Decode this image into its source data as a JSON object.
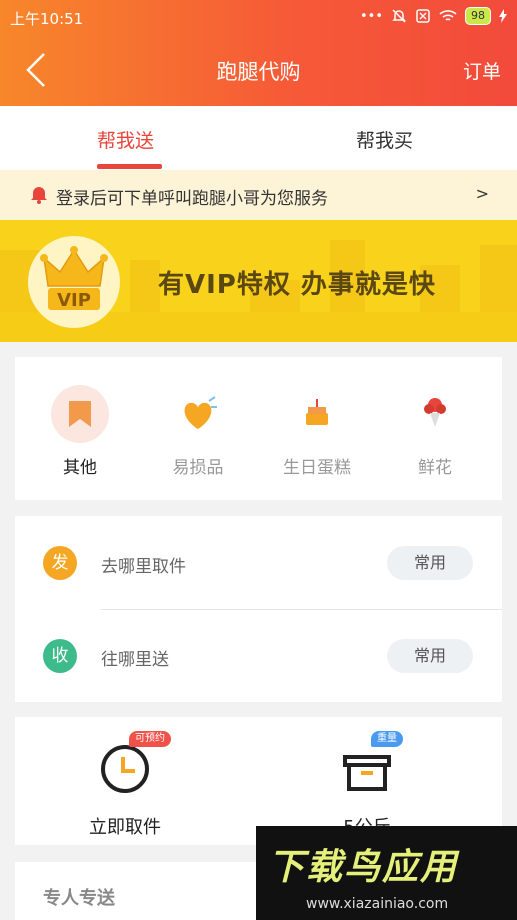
{
  "status_bar": {
    "time": "上午10:51",
    "battery": "98"
  },
  "nav": {
    "title": "跑腿代购",
    "right_action": "订单"
  },
  "tabs": [
    {
      "label": "帮我送",
      "active": true
    },
    {
      "label": "帮我买",
      "active": false
    }
  ],
  "notice": {
    "text": "登录后可下单呼叫跑腿小哥为您服务",
    "arrow": ">"
  },
  "vip_banner": {
    "badge_text": "VIP",
    "slogan": "有VIP特权  办事就是快"
  },
  "categories": [
    {
      "label": "其他",
      "icon": "bookmark-icon",
      "selected": true
    },
    {
      "label": "易损品",
      "icon": "fragile-heart-icon",
      "selected": false
    },
    {
      "label": "生日蛋糕",
      "icon": "cake-icon",
      "selected": false
    },
    {
      "label": "鲜花",
      "icon": "flower-icon",
      "selected": false
    }
  ],
  "address": {
    "pickup": {
      "badge": "发",
      "placeholder": "去哪里取件",
      "chip": "常用",
      "color": "#f5a623"
    },
    "delivery": {
      "badge": "收",
      "placeholder": "往哪里送",
      "chip": "常用",
      "color": "#3dbb8a"
    }
  },
  "options": [
    {
      "label": "立即取件",
      "tag": "可预约",
      "icon": "clock-icon",
      "tag_color": "#f0524a"
    },
    {
      "label": "5公斤",
      "tag": "重量",
      "icon": "box-icon",
      "tag_color": "#4a9bf0"
    }
  ],
  "bottom_section": {
    "title": "专人专送"
  },
  "watermark": {
    "text": "下载鸟应用",
    "url": "www.xiazainiao.com"
  },
  "colors": {
    "accent": "#e8453c",
    "header_start": "#f7872a",
    "header_end": "#f24a3b",
    "vip_yellow": "#f9d21b"
  }
}
